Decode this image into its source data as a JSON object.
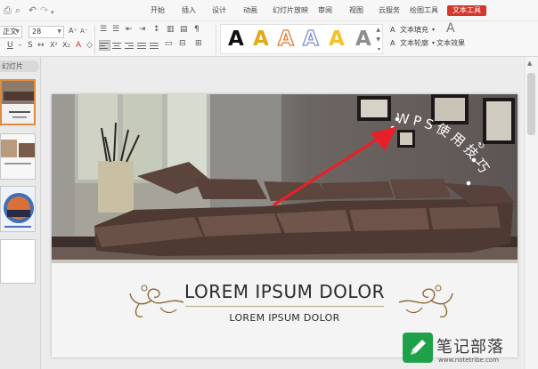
{
  "ribbon_tabs": [
    "开始",
    "插入",
    "设计",
    "动画",
    "幻灯片放映",
    "审阅",
    "视图",
    "云服务",
    "绘图工具",
    "文本工具"
  ],
  "active_tab": "文本工具",
  "font": {
    "name": "正文",
    "size": "28"
  },
  "wordart_letter": "A",
  "text_options": {
    "fill": "文本填充",
    "outline": "文本轮廓",
    "effect": "文本效果"
  },
  "pane": {
    "tab_label": "幻灯片"
  },
  "slide": {
    "curved_text": "WPS使用技巧",
    "title": "LOREM IPSUM DOLOR",
    "subtitle": "LOREM IPSUM DOLOR"
  },
  "watermark": {
    "name": "笔记部落",
    "url": "www.notetribe.com"
  },
  "colors": {
    "accent": "#d4382c",
    "arrow": "#e8202a",
    "ornament": "#8a6a34",
    "sofa": "#4e3a33"
  }
}
